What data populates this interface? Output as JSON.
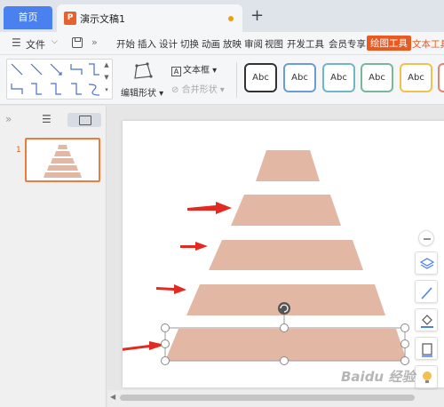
{
  "tabs": {
    "home_label": "首页",
    "doc_icon_letter": "P",
    "doc_title": "演示文稿1",
    "add_label": "+"
  },
  "menubar": {
    "file_label": "文件",
    "items": [
      "开始",
      "插入",
      "设计",
      "切换",
      "动画",
      "放映",
      "审阅",
      "视图",
      "开发工具",
      "会员专享",
      "绘图工具",
      "文本工具"
    ],
    "active_item": "绘图工具",
    "accent_color": "#e85a1f"
  },
  "toolbar": {
    "edit_shape_label": "编辑形状",
    "textbox_label": "文本框",
    "merge_shape_label": "合并形状",
    "style_swatches": [
      {
        "label": "Abc",
        "border": "#333333"
      },
      {
        "label": "Abc",
        "border": "#6d9bd8"
      },
      {
        "label": "Abc",
        "border": "#6fb8c3"
      },
      {
        "label": "Abc",
        "border": "#78b896"
      },
      {
        "label": "Abc",
        "border": "#f2c04e"
      },
      {
        "label": "",
        "border": "#e8826a"
      }
    ]
  },
  "left_panel": {
    "slide_number": "1"
  },
  "slide": {
    "shape_color": "#e2b8a4",
    "arrow_color": "#e42a20",
    "selection_stroke": "#9a9a9a",
    "layers": 5,
    "selected_layer": 5
  },
  "right_tools": [
    "zoom-out-icon",
    "layers-icon",
    "pen-icon",
    "fill-icon",
    "frame-icon",
    "lightbulb-icon"
  ],
  "watermark": "Baidu 经验"
}
